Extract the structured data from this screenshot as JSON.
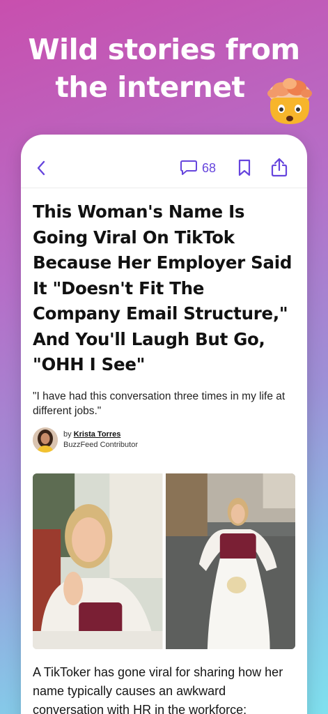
{
  "hero": {
    "line1": "Wild stories from",
    "line2": "the internet"
  },
  "toolbar": {
    "comment_count": "68"
  },
  "article": {
    "headline": "This Woman's Name Is Going Viral On TikTok Because Her Employer Said It \"Doesn't Fit The Company Email Structure,\" And You'll Laugh But Go, \"OHH I See\"",
    "dek": "\"I have had this conversation three times in my life at different jobs.\"",
    "byline_prefix": "by ",
    "author": "Krista Torres",
    "author_role": "BuzzFeed Contributor",
    "body": "A TikToker has gone viral for sharing how her name typically causes an awkward conversation with HR in the workforce:"
  },
  "icons": {
    "back": "chevron-left-icon",
    "comments": "speech-bubble-icon",
    "bookmark": "bookmark-icon",
    "share": "share-icon",
    "emoji": "exploding-head-emoji"
  },
  "colors": {
    "accent": "#6645dd"
  }
}
